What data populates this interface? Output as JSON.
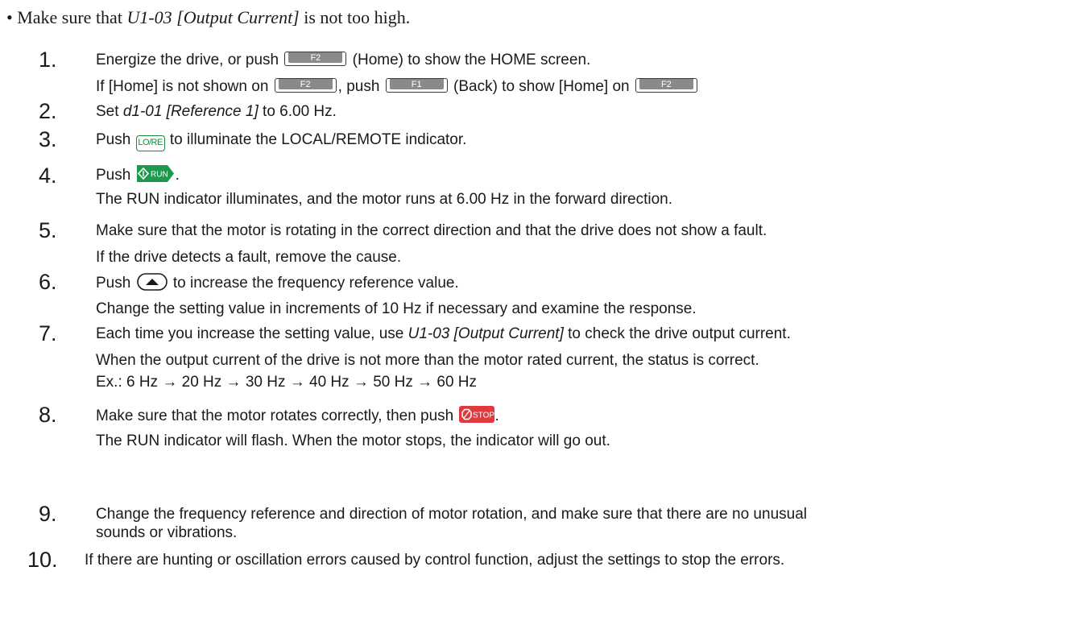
{
  "intro": {
    "prefix": "Make sure that ",
    "param": "U1-03 [Output Current]",
    "suffix": " is not too high."
  },
  "keys": {
    "f2": "F2",
    "f1": "F1",
    "lore": "LO/RE",
    "run": "RUN",
    "stop": "STOP"
  },
  "steps": [
    {
      "num": "1.",
      "line1_a": "Energize the drive, or push",
      "line1_b": "(Home) to show the HOME screen.",
      "line2_a": "If [Home] is not shown on",
      "line2_b": ", push",
      "line2_c": "(Back) to show [Home] on"
    },
    {
      "num": "2.",
      "a": "Set ",
      "param": "d1-01 [Reference 1]",
      "b": " to 6.00 Hz."
    },
    {
      "num": "3.",
      "a": "Push",
      "b": "to illuminate the LOCAL/REMOTE indicator."
    },
    {
      "num": "4.",
      "a": "Push",
      "b": ".",
      "line2": "The RUN indicator illuminates, and the motor runs at 6.00 Hz in the forward direction."
    },
    {
      "num": "5.",
      "line1": "Make sure that the motor is rotating in the correct direction and that the drive does not show a fault.",
      "line2": "If the drive detects a fault, remove the cause."
    },
    {
      "num": "6.",
      "a": "Push",
      "b": "to increase the frequency reference value.",
      "line2": "Change the setting value in increments of 10 Hz if necessary and examine the response."
    },
    {
      "num": "7.",
      "a": "Each time you increase the setting value, use ",
      "param": "U1-03 [Output Current]",
      "b": " to check the drive output current.",
      "line2": "When the output current of the drive is not more than the motor rated current, the status is correct.",
      "line3": "Ex.: 6 Hz → 20 Hz → 30 Hz → 40 Hz → 50 Hz → 60 Hz"
    },
    {
      "num": "8.",
      "a": "Make sure that the motor rotates correctly, then push",
      "b": ".",
      "line2": "The RUN indicator will flash. When the motor stops, the indicator will go out."
    },
    {
      "num": "9.",
      "line1": "Change the frequency reference and direction of motor rotation, and make sure that there are no unusual",
      "line2": "sounds or vibrations."
    },
    {
      "num": "10.",
      "line1": "If there are hunting or oscillation errors caused by control function, adjust the settings to stop the errors."
    }
  ],
  "colors": {
    "run_green": "#1a9a4a",
    "stop_red": "#e0393e",
    "lore_green": "#1a8a3a",
    "f_key_gray": "#8a8a8a"
  }
}
